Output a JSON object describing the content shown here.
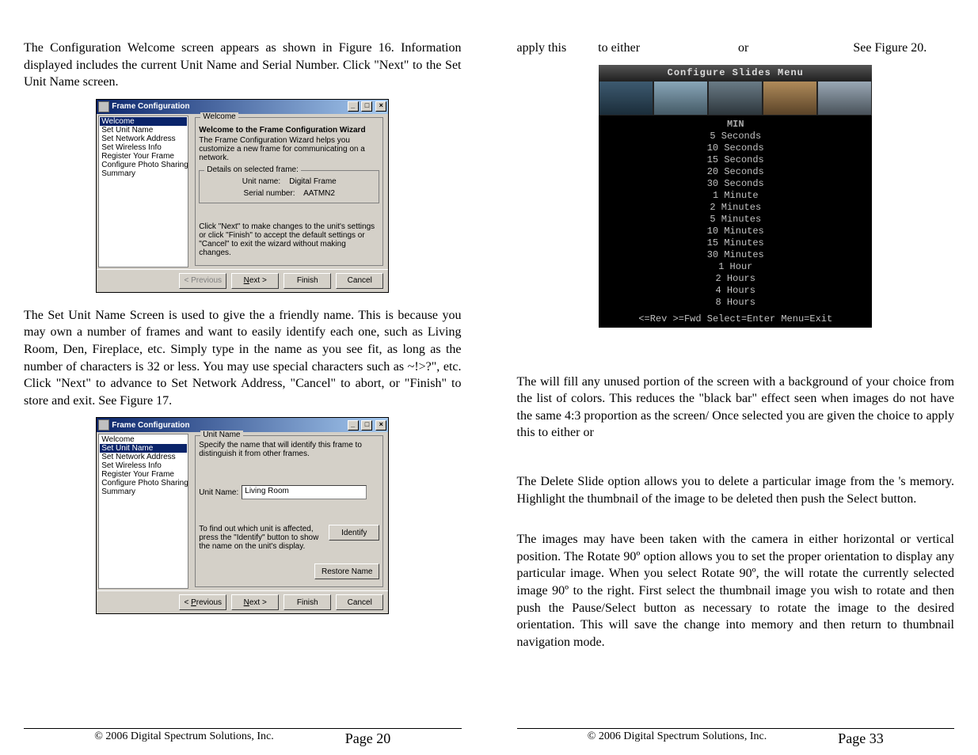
{
  "left": {
    "p1": "The Configuration Welcome screen appears as shown in Figure 16. Information displayed includes the current Unit Name and Serial Number. Click \"Next\" to the Set Unit Name screen.",
    "p2": "The Set Unit Name Screen is used to give the                          a friendly name. This is because you may own a number of frames and want to easily identify each one, such as Living Room, Den, Fireplace, etc. Simply type in the name as you see fit, as long as the number of characters is 32 or less. You may use special characters such as ~!>?\", etc.  Click \"Next\" to advance to Set Network Address, \"Cancel\" to abort, or \"Finish\" to store and exit. See Figure 17."
  },
  "right": {
    "p0a": "apply this",
    "p0b": "to either",
    "p0c": "or",
    "p0d": "See Figure 20.",
    "p_bg": "The                          will fill any unused portion of the screen with a background of your choice from the list of colors. This reduces the \"black bar\" effect seen when images do not have the same 4:3 proportion as the                          screen/ Once selected you are given the choice to apply this              to either                              or",
    "p_del": "The Delete Slide option allows you to delete a particular image from the                       's memory. Highlight the thumbnail of the image to be deleted then push the Select button.",
    "p_rot": "The images may have been taken with the camera in either horizontal or vertical position. The Rotate 90º option allows you to set the proper orientation to display any particular image. When you select Rotate 90º, the                          will rotate the currently selected image 90º to the right.  First select the thumbnail image you wish to rotate and then push the Pause/Select button as necessary to rotate the image to the desired orientation. This will save the change into memory and then return to thumbnail navigation mode."
  },
  "dialog": {
    "title": "Frame Configuration",
    "nav": [
      "Welcome",
      "Set Unit Name",
      "Set Network Address",
      "Set Wireless Info",
      "Register Your Frame",
      "Configure Photo Sharing",
      "Summary"
    ],
    "btn_prev": "< Previous",
    "btn_next": "Next >",
    "btn_finish": "Finish",
    "btn_cancel": "Cancel"
  },
  "d1": {
    "legend": "Welcome",
    "heading": "Welcome to the Frame Configuration Wizard",
    "desc": "The Frame Configuration Wizard helps you customize a new frame for communicating on a network.",
    "details_legend": "Details on selected frame:",
    "unitname_label": "Unit name:",
    "unitname_value": "Digital Frame",
    "serial_label": "Serial number:",
    "serial_value": "AATMN2",
    "hint": "Click \"Next\" to make changes to the unit's settings or click \"Finish\" to accept the default settings or \"Cancel\" to exit the wizard without making changes."
  },
  "d2": {
    "legend": "Unit Name",
    "desc": "Specify the name that will identify this frame to distinguish it from other frames.",
    "field_label": "Unit Name:",
    "field_value": "Living Room",
    "id_hint": "To find out which unit is affected, press the \"Identify\" button to show the name on the unit's display.",
    "btn_identify": "Identify",
    "btn_restore": "Restore Name"
  },
  "osd": {
    "title": "Configure Slides Menu",
    "col_header": "MIN",
    "items": [
      "5 Seconds",
      "10 Seconds",
      "15 Seconds",
      "20 Seconds",
      "30 Seconds",
      "1 Minute",
      "2 Minutes",
      "5 Minutes",
      "10 Minutes",
      "15 Minutes",
      "30 Minutes",
      "1 Hour",
      "2 Hours",
      "4 Hours",
      "8 Hours"
    ],
    "footer": "<=Rev >=Fwd Select=Enter Menu=Exit"
  },
  "footer": {
    "copyright": "© 2006 Digital Spectrum Solutions, Inc.",
    "page_left": "Page 20",
    "page_right": "Page 33"
  }
}
